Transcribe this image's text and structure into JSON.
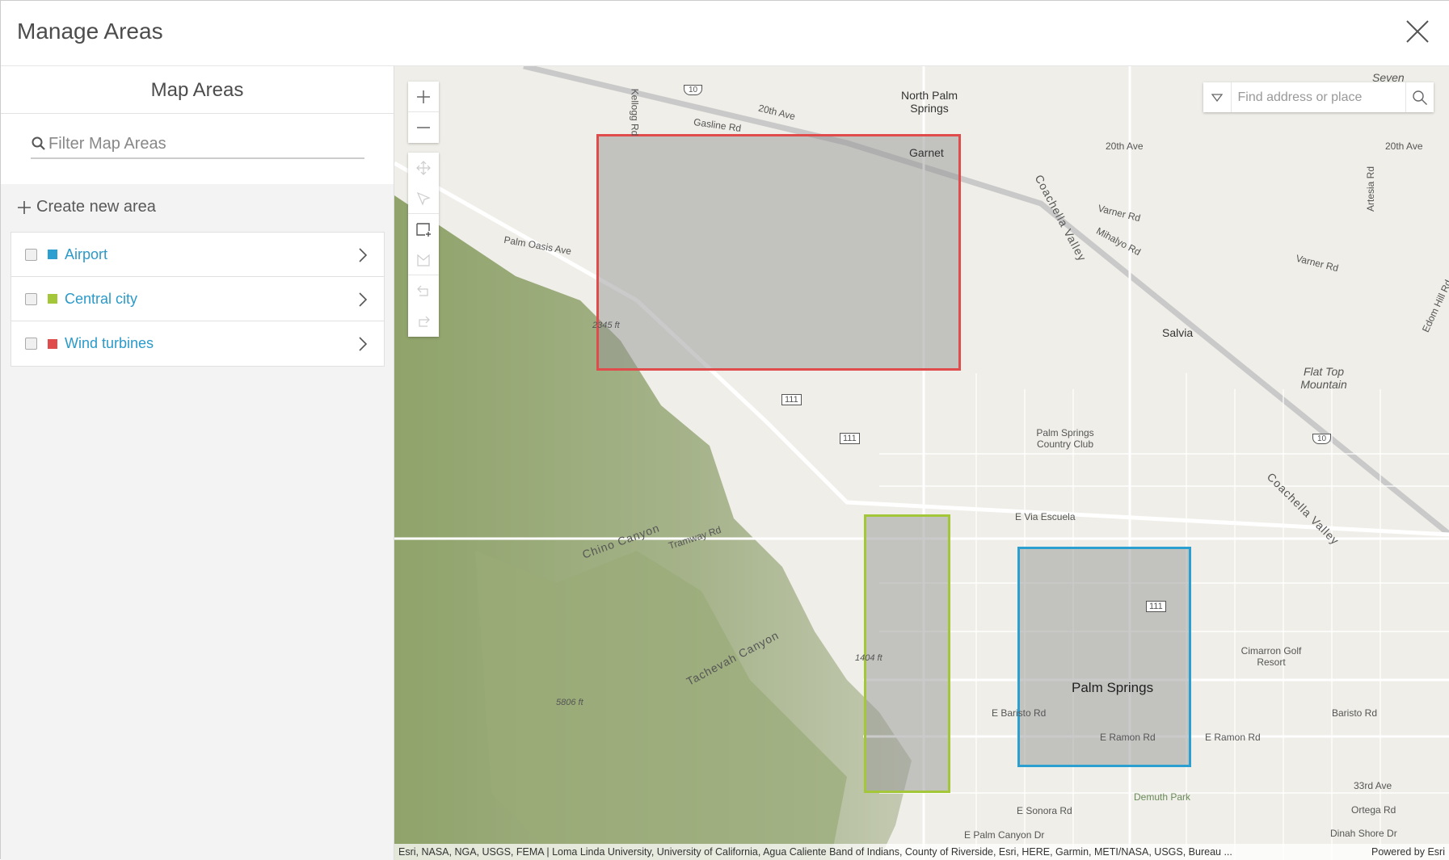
{
  "header": {
    "title": "Manage Areas",
    "close_icon": "close-icon"
  },
  "panel": {
    "title": "Map Areas",
    "filter_placeholder": "Filter Map Areas",
    "create_label": "Create new area",
    "areas": [
      {
        "label": "Airport",
        "color": "#2a9fd0",
        "checked": false
      },
      {
        "label": "Central city",
        "color": "#a4c639",
        "checked": false
      },
      {
        "label": "Wind turbines",
        "color": "#e04c4c",
        "checked": false
      }
    ]
  },
  "map": {
    "search_placeholder": "Find address or place",
    "areas_drawn": [
      {
        "name": "Wind turbines",
        "color": "#e04c4c"
      },
      {
        "name": "Central city",
        "color": "#a4c639"
      },
      {
        "name": "Airport",
        "color": "#2a9fd0"
      }
    ],
    "labels": {
      "north_palm_springs": "North Palm Springs",
      "garnet": "Garnet",
      "salvia": "Salvia",
      "palm_springs": "Palm Springs",
      "flat_top": "Flat Top Mountain",
      "ps_country_club": "Palm Springs Country Club",
      "cimarron": "Cimarron Golf Resort",
      "demuth": "Demuth Park",
      "gasline": "Gasline Rd",
      "ave20": "20th Ave",
      "ave20b": "20th Ave",
      "ave20c": "20th Ave",
      "varner": "Varner Rd",
      "varner2": "Varner Rd",
      "mihalyo": "Mihalyo Rd",
      "coachella": "Coachella Valley",
      "coachella2": "Coachella Valley",
      "palm_oasis": "Palm Oasis Ave",
      "chino": "Chino Canyon",
      "tramway": "Tramway Rd",
      "tachevah": "Tachevah Canyon",
      "via_escuela": "E Via Escuela",
      "baristo": "E Baristo Rd",
      "baristo2": "Baristo Rd",
      "ramon": "E Ramon Rd",
      "ramon2": "E Ramon Rd",
      "sonora": "E Sonora Rd",
      "palm_canyon": "E Palm Canyon Dr",
      "dinah": "Dinah Shore Dr",
      "ortega": "Ortega Rd",
      "ave33": "33rd Ave",
      "seven": "Seven",
      "elev1": "2345 ft",
      "elev2": "1404 ft",
      "elev3": "5806 ft",
      "hwy111a": "111",
      "hwy111b": "111",
      "hwy111c": "111",
      "i10a": "10",
      "i10b": "10",
      "kellogg": "Kellogg Rd",
      "edom": "Edom Hill Rd",
      "artesia": "Artesia Rd"
    },
    "attribution": "Esri, NASA, NGA, USGS, FEMA | Loma Linda University, University of California, Agua Caliente Band of Indians, County of Riverside, Esri, HERE, Garmin, METI/NASA, USGS, Bureau ...",
    "powered_by": "Powered by Esri"
  }
}
